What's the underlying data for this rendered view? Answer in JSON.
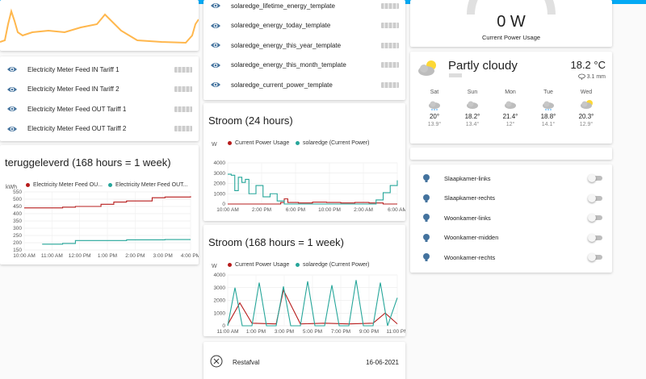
{
  "colors": {
    "accent": "#03a9f4",
    "icon": "#44739e",
    "power": "#b71c1c",
    "solar": "#26a69a",
    "orange": "#ffb74d"
  },
  "left_entities": [
    {
      "label": "Electricity Meter Feed IN Tariff 1",
      "icon": "eye-icon"
    },
    {
      "label": "Electricity Meter Feed IN Tariff 2",
      "icon": "eye-icon"
    },
    {
      "label": "Electricity Meter Feed OUT Tariff 1",
      "icon": "eye-icon"
    },
    {
      "label": "Electricity Meter Feed OUT Tariff 2",
      "icon": "eye-icon"
    }
  ],
  "teruggeleverd": {
    "title": "teruggeleverd (168 hours = 1 week)",
    "legend": [
      "Electricity Meter Feed OU...",
      "Electricity Meter Feed OUT..."
    ],
    "unit": "kWh"
  },
  "mid_entities": [
    {
      "label": "solaredge_lifetime_energy_template",
      "icon": "eye-icon"
    },
    {
      "label": "solaredge_energy_today_template",
      "icon": "eye-icon"
    },
    {
      "label": "solaredge_energy_this_year_template",
      "icon": "eye-icon"
    },
    {
      "label": "solaredge_energy_this_month_template",
      "icon": "eye-icon"
    },
    {
      "label": "solaredge_current_power_template",
      "icon": "eye-icon"
    }
  ],
  "stroom24": {
    "title": "Stroom (24 hours)",
    "legend": [
      "Current Power Usage",
      "solaredge (Current Power)"
    ],
    "unit": "W"
  },
  "stroom168": {
    "title": "Stroom (168 hours = 1 week)",
    "legend": [
      "Current Power Usage",
      "solaredge (Current Power)"
    ],
    "unit": "W"
  },
  "restafval": {
    "label": "Restafval",
    "date": "16-06-2021",
    "icon": "trash-can-icon"
  },
  "gauge": {
    "value": "0 W",
    "name": "Current Power Usage"
  },
  "weather": {
    "condition": "Partly cloudy",
    "temperature": "18.2 °C",
    "precipitation": "3.1 mm",
    "forecast": [
      {
        "day": "Sat",
        "high": "20°",
        "low": "13.9°",
        "icon": "cloud-rain-icon"
      },
      {
        "day": "Sun",
        "high": "18.2°",
        "low": "13.4°",
        "icon": "cloud-icon"
      },
      {
        "day": "Mon",
        "high": "21.4°",
        "low": "12°",
        "icon": "cloud-icon"
      },
      {
        "day": "Tue",
        "high": "18.8°",
        "low": "14.1°",
        "icon": "cloud-rain-icon"
      },
      {
        "day": "Wed",
        "high": "20.3°",
        "low": "12.9°",
        "icon": "partly-cloudy-icon"
      }
    ]
  },
  "lights": [
    {
      "label": "Slaapkamer-links",
      "icon": "bulb-icon",
      "on": false
    },
    {
      "label": "Slaapkamer-rechts",
      "icon": "bulb-icon",
      "on": false
    },
    {
      "label": "Woonkamer-links",
      "icon": "bulb-icon",
      "on": false
    },
    {
      "label": "Woonkamer-midden",
      "icon": "bulb-icon",
      "on": false
    },
    {
      "label": "Woonkamer-rechts",
      "icon": "bulb-icon",
      "on": false
    }
  ],
  "chart_data": [
    {
      "type": "line",
      "title": "teruggeleverd (168 hours = 1 week)",
      "ylabel": "kWh",
      "x_ticks": [
        "10:00 AM",
        "11:00 AM",
        "12:00 PM",
        "1:00 PM",
        "2:00 PM",
        "3:00 PM",
        "4:00 PM"
      ],
      "y_ticks": [
        150,
        200,
        250,
        300,
        350,
        400,
        450,
        500,
        550
      ],
      "ylim": [
        150,
        550
      ],
      "series": [
        {
          "name": "Electricity Meter Feed OU...",
          "x": [
            0.0,
            1.5,
            2.0,
            3.0,
            3.5,
            4.0,
            5.0,
            5.5,
            6.5
          ],
          "values": [
            440,
            445,
            450,
            465,
            480,
            488,
            510,
            515,
            520
          ]
        },
        {
          "name": "Electricity Meter Feed OUT...",
          "x": [
            0.7,
            1.5,
            2.0,
            4.0,
            5.0,
            5.5,
            6.5
          ],
          "values": [
            190,
            195,
            215,
            220,
            220,
            222,
            222
          ]
        }
      ]
    },
    {
      "type": "line",
      "title": "Stroom (24 hours)",
      "ylabel": "W",
      "x_ticks": [
        "10:00 AM",
        "2:00 PM",
        "6:00 PM",
        "10:00 PM",
        "2:00 AM",
        "6:00 AM"
      ],
      "y_ticks": [
        0,
        1000,
        2000,
        3000,
        4000
      ],
      "ylim": [
        0,
        4000
      ],
      "series": [
        {
          "name": "Current Power Usage",
          "x": [
            0,
            2,
            4,
            6,
            7.5,
            8,
            8.5,
            10,
            12,
            14,
            16,
            18,
            20,
            22,
            24
          ],
          "values": [
            0,
            0,
            0,
            0,
            150,
            500,
            150,
            100,
            180,
            150,
            100,
            150,
            100,
            0,
            0
          ]
        },
        {
          "name": "solaredge (Current Power)",
          "x": [
            0,
            0.5,
            1,
            1.5,
            2,
            2.5,
            3,
            4,
            5,
            6,
            7,
            8,
            9,
            20,
            21,
            22,
            23,
            24
          ],
          "values": [
            2900,
            2800,
            1300,
            2600,
            2100,
            2400,
            1000,
            1800,
            700,
            1000,
            300,
            0,
            0,
            0,
            400,
            1100,
            1800,
            2300
          ]
        }
      ]
    },
    {
      "type": "line",
      "title": "Stroom (168 hours = 1 week)",
      "ylabel": "W",
      "x_ticks": [
        "11:00 AM",
        "1:00 PM",
        "3:00 PM",
        "5:00 PM",
        "7:00 PM",
        "9:00 PM",
        "11:00 PM"
      ],
      "y_ticks": [
        0,
        1000,
        2000,
        3000,
        4000
      ],
      "ylim": [
        0,
        4000
      ],
      "series": [
        {
          "name": "Current Power Usage",
          "x": [
            0,
            0.5,
            1,
            2,
            2.3,
            3,
            4,
            5,
            6,
            6.5,
            7
          ],
          "values": [
            100,
            1800,
            200,
            150,
            2800,
            150,
            200,
            150,
            200,
            1000,
            150
          ]
        },
        {
          "name": "solaredge (Current Power)",
          "x": [
            0,
            0.3,
            0.6,
            1,
            1.3,
            1.6,
            2,
            2.3,
            2.6,
            3,
            3.3,
            3.6,
            4,
            4.3,
            4.6,
            5,
            5.3,
            5.6,
            6,
            6.3,
            6.6,
            7
          ],
          "values": [
            0,
            3000,
            0,
            0,
            3400,
            0,
            0,
            3100,
            0,
            0,
            3500,
            0,
            0,
            3200,
            0,
            0,
            3600,
            0,
            0,
            3400,
            0,
            2200
          ]
        }
      ]
    }
  ]
}
